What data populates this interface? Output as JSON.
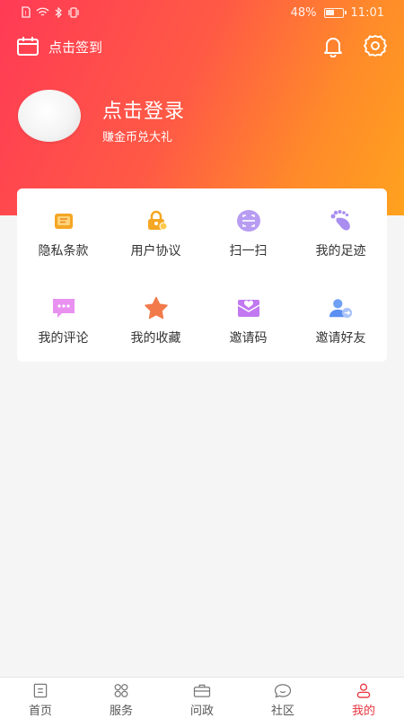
{
  "status_bar": {
    "battery": "48%",
    "time": "11:01"
  },
  "header": {
    "signin_label": "点击签到",
    "login_title": "点击登录",
    "login_subtitle": "赚金币兑大礼"
  },
  "menu": {
    "items": [
      {
        "label": "隐私条款",
        "icon": "privacy-document-icon",
        "color": "#f5a623"
      },
      {
        "label": "用户协议",
        "icon": "user-agreement-lock-icon",
        "color": "#f5a623"
      },
      {
        "label": "扫一扫",
        "icon": "scan-icon",
        "color": "#b79cf2"
      },
      {
        "label": "我的足迹",
        "icon": "footprint-icon",
        "color": "#a98ef0"
      },
      {
        "label": "我的评论",
        "icon": "comment-icon",
        "color": "#e991f0"
      },
      {
        "label": "我的收藏",
        "icon": "star-icon",
        "color": "#f27a4a"
      },
      {
        "label": "邀请码",
        "icon": "invite-code-envelope-icon",
        "color": "#c178f0"
      },
      {
        "label": "邀请好友",
        "icon": "invite-friend-icon",
        "color": "#5b8ff2"
      }
    ]
  },
  "tabs": [
    {
      "label": "首页",
      "icon": "home-news-icon"
    },
    {
      "label": "服务",
      "icon": "service-grid-icon"
    },
    {
      "label": "问政",
      "icon": "briefcase-icon"
    },
    {
      "label": "社区",
      "icon": "community-chat-icon"
    },
    {
      "label": "我的",
      "icon": "profile-icon",
      "active": true
    }
  ],
  "colors": {
    "accent": "#e8343e",
    "gradient_start": "#ff3a55",
    "gradient_end": "#ffa21e"
  }
}
